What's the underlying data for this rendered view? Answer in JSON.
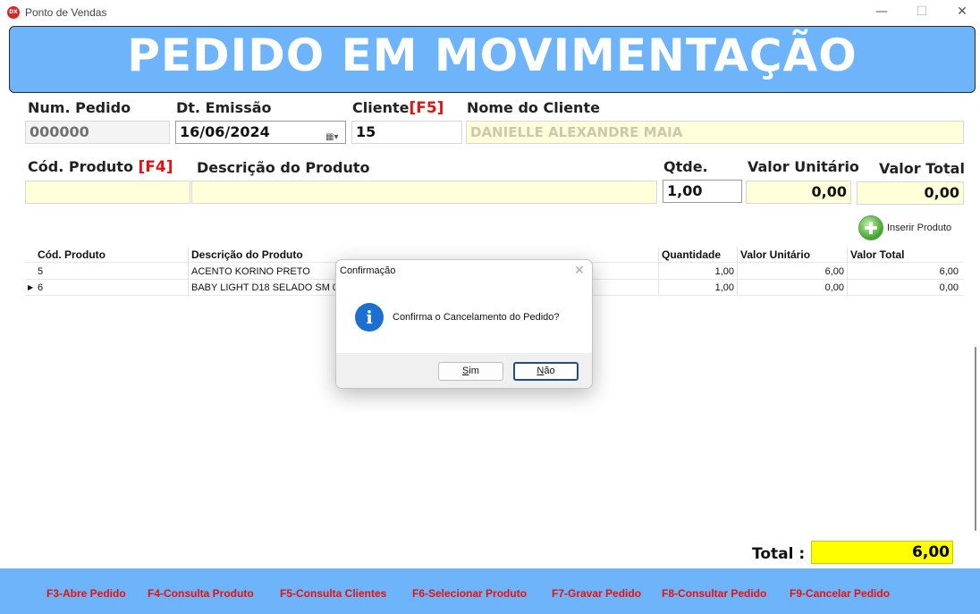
{
  "window": {
    "app_icon_text": "DX",
    "title": "Ponto de Vendas"
  },
  "banner": {
    "title": "PEDIDO EM MOVIMENTAÇÃO"
  },
  "header_fields": {
    "num_pedido_label": "Num. Pedido",
    "num_pedido_value": "000000",
    "dt_emissao_label": "Dt. Emissão",
    "dt_emissao_value": "16/06/2024",
    "cliente_label": "Cliente",
    "cliente_key": "[F5]",
    "cliente_value": "15",
    "nome_cliente_label": "Nome do Cliente",
    "nome_cliente_value": "DANIELLE ALEXANDRE MAIA"
  },
  "product_entry": {
    "cod_label": "Cód. Produto",
    "cod_key": "[F4]",
    "cod_value": "",
    "desc_label": "Descrição do Produto",
    "desc_value": "",
    "qtde_label": "Qtde.",
    "qtde_value": "1,00",
    "valor_unit_label": "Valor Unitário",
    "valor_unit_value": "0,00",
    "valor_total_label": "Valor Total",
    "valor_total_value": "0,00",
    "insert_button_label": "Inserir Produto"
  },
  "grid": {
    "headers": [
      "Cód. Produto",
      "Descrição do Produto",
      "Quantidade",
      "Valor Unitário",
      "Valor Total"
    ],
    "rows": [
      {
        "cod": "5",
        "desc": "ACENTO KORINO PRETO",
        "qtd": "1,00",
        "vu": "6,00",
        "vt": "6,00",
        "selected": false
      },
      {
        "cod": "6",
        "desc": "BABY LIGHT D18 SELADO SM 0700",
        "qtd": "1,00",
        "vu": "0,00",
        "vt": "0,00",
        "selected": true
      }
    ]
  },
  "total": {
    "label": "Total :",
    "value": "6,00"
  },
  "footer_keys": [
    "F3-Abre Pedido",
    "F4-Consulta Produto",
    "F5-Consulta Clientes",
    "F6-Selecionar Produto",
    "F7-Gravar Pedido",
    "F8-Consultar Pedido",
    "F9-Cancelar Pedido"
  ],
  "dialog": {
    "title": "Confirmação",
    "message": "Confirma o Cancelamento do Pedido?",
    "yes_accel": "S",
    "yes_rest": "im",
    "no_accel": "N",
    "no_rest": "ão"
  },
  "colors": {
    "banner_bg": "#6eb4fb",
    "key_red": "#e51010",
    "entry_yellow": "#ffffd9",
    "total_yellow": "#ffff00"
  }
}
